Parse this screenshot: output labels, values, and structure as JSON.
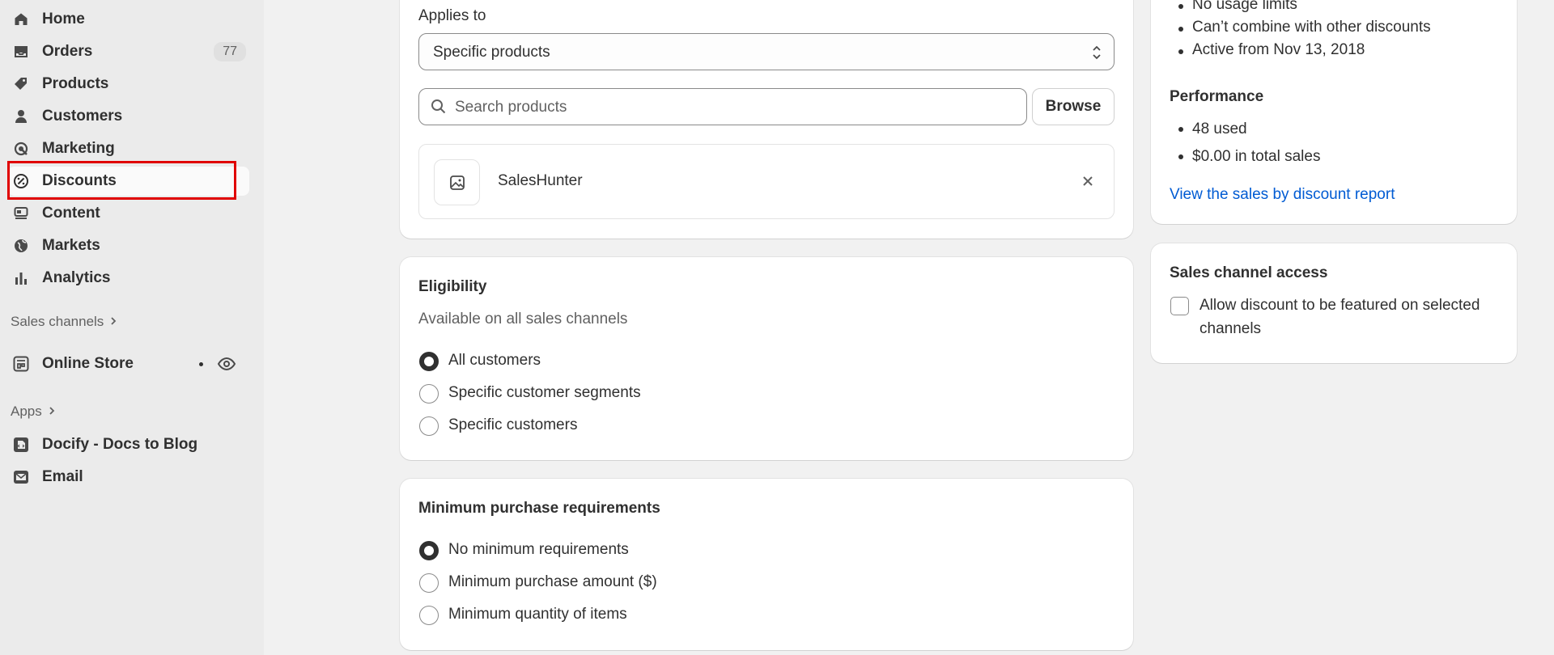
{
  "sidebar": {
    "items": [
      {
        "label": "Home",
        "icon": "home-icon"
      },
      {
        "label": "Orders",
        "icon": "orders-inbox-icon",
        "badge": "77"
      },
      {
        "label": "Products",
        "icon": "tag-icon"
      },
      {
        "label": "Customers",
        "icon": "person-icon"
      },
      {
        "label": "Marketing",
        "icon": "target-icon"
      },
      {
        "label": "Discounts",
        "icon": "discount-icon"
      },
      {
        "label": "Content",
        "icon": "content-icon"
      },
      {
        "label": "Markets",
        "icon": "globe-icon"
      },
      {
        "label": "Analytics",
        "icon": "bar-chart-icon"
      }
    ],
    "sales_channels_label": "Sales channels",
    "online_store_label": "Online Store",
    "apps_label": "Apps",
    "apps": [
      {
        "label": "Docify - Docs to Blog",
        "icon": "docify-app-icon"
      },
      {
        "label": "Email",
        "icon": "email-icon"
      }
    ]
  },
  "applies": {
    "label": "Applies to",
    "select_value": "Specific products",
    "search_placeholder": "Search products",
    "browse_label": "Browse",
    "product_name": "SalesHunter"
  },
  "eligibility": {
    "title": "Eligibility",
    "subtitle": "Available on all sales channels",
    "options": [
      "All customers",
      "Specific customer segments",
      "Specific customers"
    ],
    "selected_index": 0
  },
  "minimum": {
    "title": "Minimum purchase requirements",
    "options": [
      "No minimum requirements",
      "Minimum purchase amount ($)",
      "Minimum quantity of items"
    ],
    "selected_index": 0
  },
  "summary": {
    "details": [
      "No usage limits",
      "Can’t combine with other discounts",
      "Active from Nov 13, 2018"
    ],
    "performance_title": "Performance",
    "performance": [
      "48 used",
      "$0.00 in total sales"
    ],
    "report_link": "View the sales by discount report"
  },
  "sales_channel": {
    "title": "Sales channel access",
    "checkbox_label_line1": "Allow discount to be featured on selected",
    "checkbox_label_line2": "channels",
    "checked": false
  },
  "colors": {
    "accent_link": "#005bd3",
    "highlight_border": "#e00000"
  }
}
